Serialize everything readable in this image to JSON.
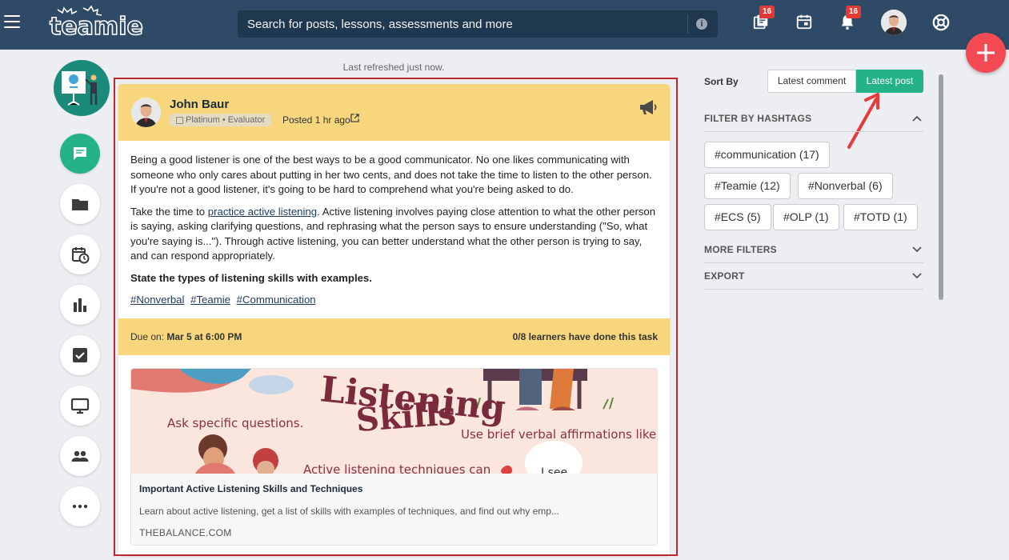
{
  "topbar": {
    "logo_text": "teamie",
    "search_placeholder": "Search for posts, lessons, assessments and more",
    "notifications": [
      {
        "icon": "library-icon",
        "badge": "16"
      },
      {
        "icon": "calendar-icon",
        "badge": ""
      },
      {
        "icon": "bell-icon",
        "badge": "16"
      }
    ],
    "help_icon": "lifebuoy-icon"
  },
  "fab_icon": "plus-icon",
  "left_rail": [
    {
      "icon": "chat-bubble-icon",
      "active": true
    },
    {
      "icon": "folder-icon"
    },
    {
      "icon": "calendar-clock-icon"
    },
    {
      "icon": "bar-chart-icon"
    },
    {
      "icon": "checkbox-icon"
    },
    {
      "icon": "monitor-icon"
    },
    {
      "icon": "people-icon"
    },
    {
      "icon": "more-dots-icon"
    }
  ],
  "feed": {
    "last_refreshed": "Last refreshed just now."
  },
  "post": {
    "author": "John Baur",
    "role": "Platinum • Evaluator",
    "posted": "Posted 1 hr ago",
    "paragraph1": "Being a good listener is one of the best ways to be a good communicator. No one likes communicating with someone who only cares about putting in her two cents, and does not take the time to listen to the other person. If you're not a good listener, it's going to be hard to comprehend what you're being asked to do.",
    "paragraph2_pre": "Take the time to ",
    "paragraph2_link": "practice active listening",
    "paragraph2_post": ". Active listening involves paying close attention to what the other person is saying, asking clarifying questions, and rephrasing what the person says to ensure understanding (\"So, what you're saying is...\"). Through active listening, you can better understand what the other person is trying to say, and can respond appropriately.",
    "question": "State the types of listening skills with examples.",
    "hashtags": [
      "#Nonverbal",
      "#Teamie",
      "#Communication"
    ],
    "due_label": "Due on: ",
    "due_value": "Mar 5 at 6:00 PM",
    "progress": "0/8 learners have done this task",
    "preview": {
      "image_text_1": "Listening",
      "image_text_2": "Skills",
      "image_text_3": "Ask specific questions.",
      "image_text_4": "Use brief verbal affirmations like:",
      "image_text_5": "Active listening techniques can",
      "image_text_6": "I see",
      "title": "Important Active Listening Skills and Techniques",
      "description": "Learn about active listening, get a list of skills with examples of techniques, and find out why emp...",
      "domain": "THEBALANCE.COM"
    }
  },
  "sidebar": {
    "sort_label": "Sort By",
    "sort_options": [
      "Latest comment",
      "Latest post"
    ],
    "active_sort": "Latest post",
    "filter_hashtags_label": "FILTER BY HASHTAGS",
    "tags": [
      "#communication (17)",
      "#Teamie (12)",
      "#Nonverbal (6)",
      "#ECS (5)",
      "#OLP (1)",
      "#TOTD (1)"
    ],
    "more_filters_label": "MORE FILTERS",
    "export_label": "EXPORT"
  },
  "colors": {
    "topbar": "#2f4a66",
    "accent_green": "#23b386",
    "post_header": "#f8d67d",
    "fab": "#f44a53",
    "highlight_outline": "#c0272d"
  }
}
